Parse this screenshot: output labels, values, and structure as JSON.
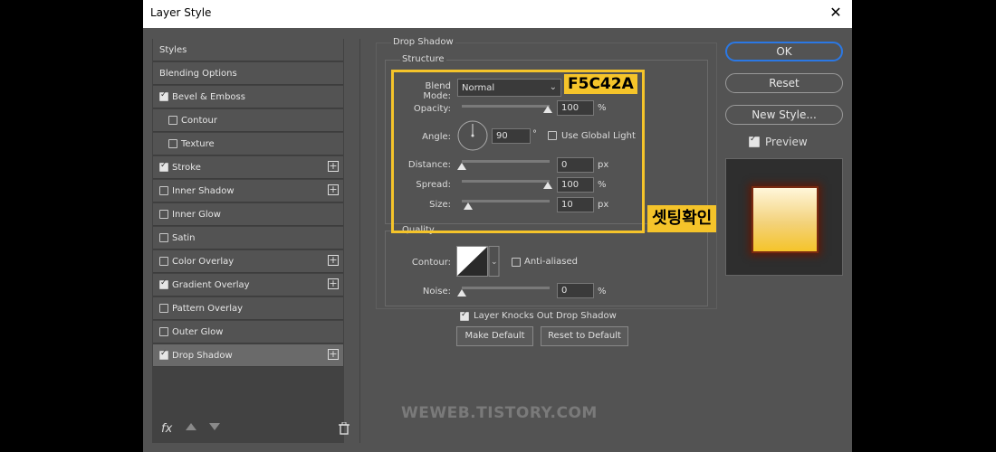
{
  "window": {
    "title": "Layer Style",
    "close_label": "✕"
  },
  "styles_list": [
    {
      "label": "Styles",
      "checkbox": null,
      "plus": false
    },
    {
      "label": "Blending Options",
      "checkbox": null,
      "plus": false
    },
    {
      "label": "Bevel & Emboss",
      "checkbox": true,
      "plus": false
    },
    {
      "label": "Contour",
      "checkbox": false,
      "plus": false,
      "indent": true
    },
    {
      "label": "Texture",
      "checkbox": false,
      "plus": false,
      "indent": true
    },
    {
      "label": "Stroke",
      "checkbox": true,
      "plus": true
    },
    {
      "label": "Inner Shadow",
      "checkbox": false,
      "plus": true
    },
    {
      "label": "Inner Glow",
      "checkbox": false,
      "plus": false
    },
    {
      "label": "Satin",
      "checkbox": false,
      "plus": false
    },
    {
      "label": "Color Overlay",
      "checkbox": false,
      "plus": true
    },
    {
      "label": "Gradient Overlay",
      "checkbox": true,
      "plus": true
    },
    {
      "label": "Pattern Overlay",
      "checkbox": false,
      "plus": false
    },
    {
      "label": "Outer Glow",
      "checkbox": false,
      "plus": false
    },
    {
      "label": "Drop Shadow",
      "checkbox": true,
      "plus": true,
      "selected": true
    }
  ],
  "footer": {
    "fx_label": "fx",
    "up_icon": "arrow-up-icon",
    "down_icon": "arrow-down-icon",
    "trash_icon": "trash-icon"
  },
  "drop_shadow": {
    "section_title": "Drop Shadow",
    "structure_title": "Structure",
    "blend_mode": {
      "label": "Blend Mode:",
      "value": "Normal"
    },
    "opacity": {
      "label": "Opacity:",
      "value": "100",
      "unit": "%",
      "level": 1.0
    },
    "angle": {
      "label": "Angle:",
      "value": "90",
      "unit": "°",
      "global_light_label": "Use Global Light",
      "global_light": false
    },
    "distance": {
      "label": "Distance:",
      "value": "0",
      "unit": "px",
      "level": 0.0
    },
    "spread": {
      "label": "Spread:",
      "value": "100",
      "unit": "%",
      "level": 1.0
    },
    "size": {
      "label": "Size:",
      "value": "10",
      "unit": "px",
      "level": 0.07
    },
    "quality_title": "Quality",
    "contour": {
      "label": "Contour:",
      "anti_aliased_label": "Anti-aliased",
      "anti_aliased": false
    },
    "noise": {
      "label": "Noise:",
      "value": "0",
      "unit": "%",
      "level": 0.0
    },
    "knockout_label": "Layer Knocks Out Drop Shadow",
    "knockout": true,
    "make_default_label": "Make Default",
    "reset_default_label": "Reset to Default"
  },
  "buttons": {
    "ok": "OK",
    "reset": "Reset",
    "new_style": "New Style...",
    "preview_label": "Preview",
    "preview": true
  },
  "annotations": {
    "color_tag": "F5C42A",
    "korean_tag": "셋팅확인",
    "highlight_color": "#f5c42a"
  },
  "watermark": "WEWEB.TISTORY.COM",
  "colors": {
    "accent": "#2b78e4",
    "preview_gold": "#f5c42a"
  }
}
